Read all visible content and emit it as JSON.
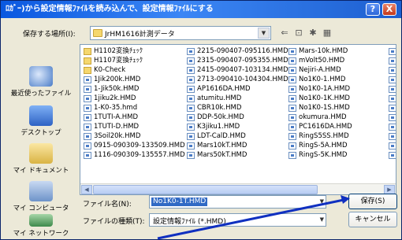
{
  "window": {
    "title": "ﾛｶﾞｰ)から設定情報ﾌｧｲﾙを読み込んで、設定情報ﾌｧｲﾙにする",
    "help_label": "?",
    "close_label": "X"
  },
  "location": {
    "label": "保存する場所(I):",
    "value": "JrHM1616計測データ"
  },
  "toolbar": {
    "back_icon": "back-arrow-icon",
    "up_icon": "up-folder-icon",
    "new_folder_icon": "new-folder-icon",
    "view_icon": "view-menu-icon"
  },
  "places": [
    {
      "label": "最近使ったファイル",
      "icon": "recent-icon",
      "color": "#4a7cc7"
    },
    {
      "label": "デスクトップ",
      "icon": "desktop-icon",
      "color": "#3a6fc2"
    },
    {
      "label": "マイ ドキュメント",
      "icon": "my-documents-icon",
      "color": "#e3c25a"
    },
    {
      "label": "マイ コンピュータ",
      "icon": "my-computer-icon",
      "color": "#6d93c9"
    },
    {
      "label": "マイ ネットワーク",
      "icon": "my-network-icon",
      "color": "#3e8a4b"
    }
  ],
  "files": {
    "col1": [
      {
        "name": "H1102変換ﾁｪｯｸ",
        "type": "folder"
      },
      {
        "name": "H1107変換ﾁｪｯｸ",
        "type": "folder"
      },
      {
        "name": "K0-Check",
        "type": "folder"
      },
      {
        "name": "1Jik200k.HMD",
        "type": "file"
      },
      {
        "name": "1-Jik50k.HMD",
        "type": "file"
      },
      {
        "name": "1jiku2k.HMD",
        "type": "file"
      },
      {
        "name": "1-K0-35.hmd",
        "type": "file"
      },
      {
        "name": "1TUTI-A.HMD",
        "type": "file"
      },
      {
        "name": "1TUTI-D.HMD",
        "type": "file"
      },
      {
        "name": "3Soil20k.HMD",
        "type": "file"
      },
      {
        "name": "0915-090309-133509.HMD",
        "type": "file"
      },
      {
        "name": "1116-090309-135557.HMD",
        "type": "file"
      }
    ],
    "col2": [
      {
        "name": "2215-090407-095116.HMD",
        "type": "file"
      },
      {
        "name": "2315-090407-095355.HMD",
        "type": "file"
      },
      {
        "name": "2415-090407-103134.HMD",
        "type": "file"
      },
      {
        "name": "2713-090410-104304.HMD",
        "type": "file"
      },
      {
        "name": "AP1616DA.HMD",
        "type": "file"
      },
      {
        "name": "atumitu.HMD",
        "type": "file"
      },
      {
        "name": "CBR10k.HMD",
        "type": "file"
      },
      {
        "name": "DDP-50k.HMD",
        "type": "file"
      },
      {
        "name": "K3jiku1.HMD",
        "type": "file"
      },
      {
        "name": "LDT-CalD.HMD",
        "type": "file"
      },
      {
        "name": "Mars10kT.HMD",
        "type": "file"
      },
      {
        "name": "Mars50kT.HMD",
        "type": "file"
      }
    ],
    "col3": [
      {
        "name": "Mars-10k.HMD",
        "type": "file"
      },
      {
        "name": "mVolt50.HMD",
        "type": "file"
      },
      {
        "name": "Nejiri-A.HMD",
        "type": "file"
      },
      {
        "name": "No1K0-1.HMD",
        "type": "file"
      },
      {
        "name": "No1K0-1A.HMD",
        "type": "file"
      },
      {
        "name": "No1K0-1K.HMD",
        "type": "file"
      },
      {
        "name": "No1K0-1S.HMD",
        "type": "file"
      },
      {
        "name": "okumura.HMD",
        "type": "file"
      },
      {
        "name": "PC1616DA.HMD",
        "type": "file"
      },
      {
        "name": "RingS5SS.HMD",
        "type": "file"
      },
      {
        "name": "RingS-5A.HMD",
        "type": "file"
      },
      {
        "name": "RingS-5K.HMD",
        "type": "file"
      }
    ]
  },
  "filename": {
    "label": "ファイル名(N):",
    "value": "No1K0-1T.HMD"
  },
  "filetype": {
    "label": "ファイルの種類(T):",
    "value": "設定情報ﾌｧｲﾙ (*.HMD)"
  },
  "buttons": {
    "save": "保存(S)",
    "cancel": "キャンセル"
  },
  "colors": {
    "titlebar": "#0a58e0",
    "annotation_arrow": "#1030c0",
    "selection": "#316ac5"
  }
}
